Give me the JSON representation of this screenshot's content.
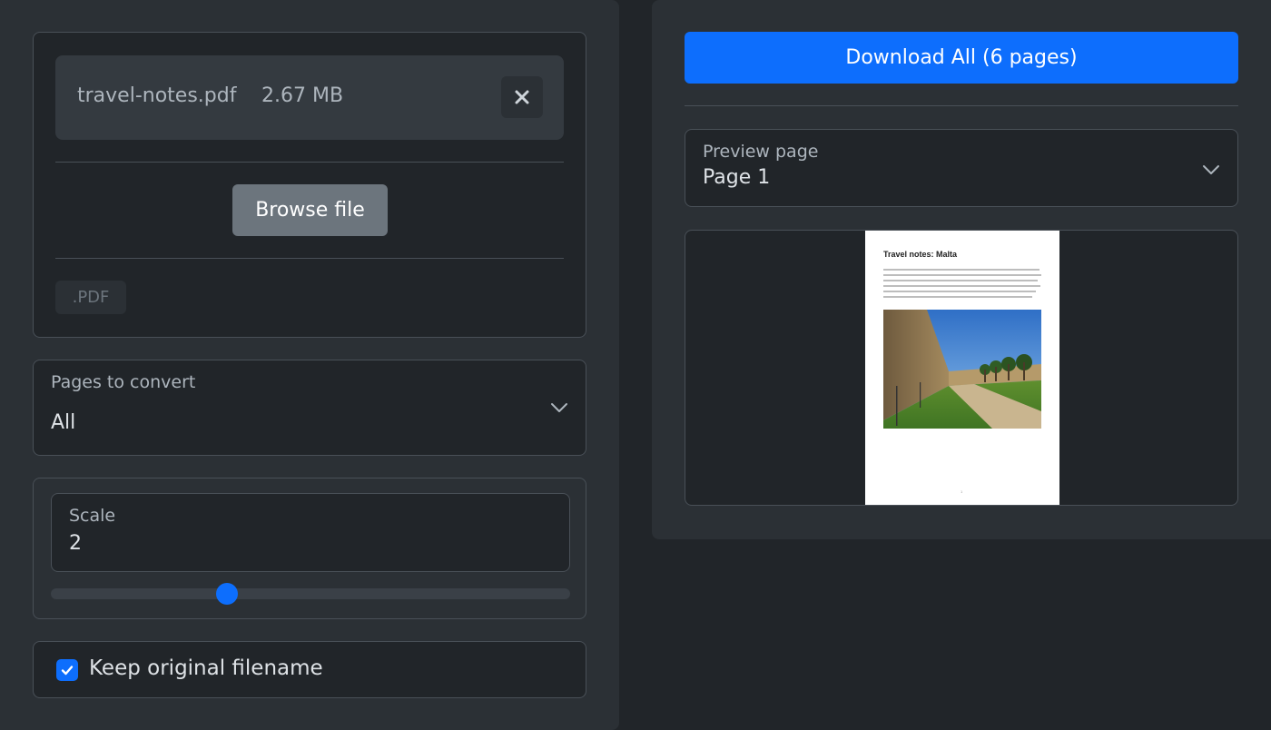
{
  "file": {
    "name": "travel-notes.pdf",
    "size": "2.67 MB",
    "remove_icon": "close-icon"
  },
  "upload": {
    "browse_label": "Browse file",
    "accepted_type": ".PDF"
  },
  "pages_select": {
    "label": "Pages to convert",
    "value": "All"
  },
  "scale": {
    "label": "Scale",
    "value": "2",
    "slider_fraction": 0.34
  },
  "options": {
    "keep_filename_label": "Keep original filename",
    "keep_filename_checked": true
  },
  "actions": {
    "download_label": "Download All (6 pages)"
  },
  "preview": {
    "label": "Preview page",
    "value": "Page 1",
    "page_title": "Travel notes: Malta",
    "page_number": "1"
  },
  "colors": {
    "accent": "#0d6efd",
    "background": "#212529",
    "panel": "#2b3035",
    "border": "#495057",
    "secondary_button": "#6c757d"
  }
}
